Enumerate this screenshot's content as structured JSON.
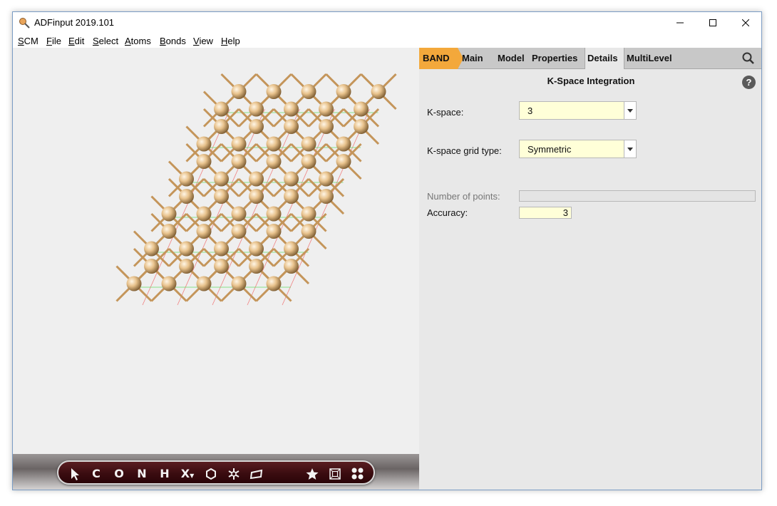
{
  "window": {
    "title": "ADFinput 2019.101"
  },
  "menubar": [
    "SCM",
    "File",
    "Edit",
    "Select",
    "Atoms",
    "Bonds",
    "View",
    "Help"
  ],
  "toolbar": {
    "items": [
      "C",
      "O",
      "N",
      "H",
      "X"
    ],
    "icons": [
      "select-arrow-icon",
      "ring-icon",
      "snowflake-icon",
      "plane-icon",
      "star-icon",
      "box-icon",
      "molecule-icon"
    ]
  },
  "panel": {
    "tabs": {
      "band": "BAND",
      "main": "Main",
      "model": "Model",
      "properties": "Properties",
      "details": "Details",
      "multilevel": "MultiLevel"
    },
    "section_title": "K-Space Integration",
    "help": "?",
    "kspace": {
      "label": "K-space:",
      "value": "3"
    },
    "grid_type": {
      "label": "K-space grid type:",
      "value": "Symmetric"
    },
    "num_points": {
      "label": "Number of points:",
      "value": ""
    },
    "accuracy": {
      "label": "Accuracy:",
      "value": "3"
    }
  },
  "colors": {
    "band_tab": "#f3a83b",
    "input_bg": "#ffffd8",
    "atom": "#e8c28c",
    "bond": "#c4955a"
  }
}
